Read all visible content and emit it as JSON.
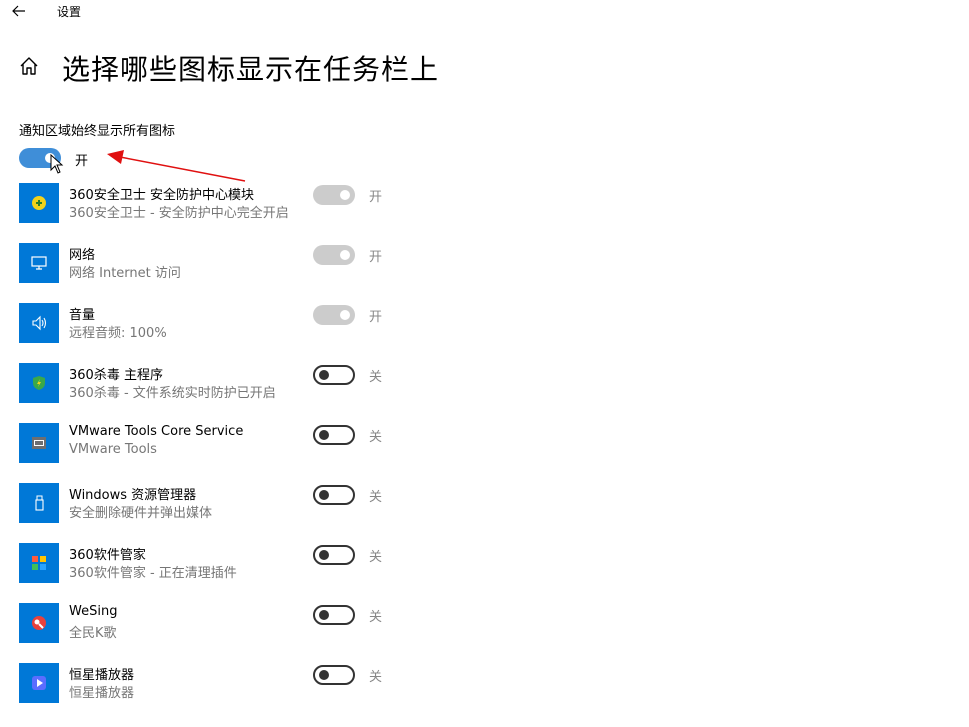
{
  "window": {
    "title": "设置"
  },
  "page": {
    "title": "选择哪些图标显示在任务栏上"
  },
  "master": {
    "label": "通知区域始终显示所有图标",
    "state": "开"
  },
  "apps": [
    {
      "name": "360安全卫士 安全防护中心模块",
      "desc": "360安全卫士 - 安全防护中心完全开启",
      "state": "开",
      "icon": "360-shield-icon"
    },
    {
      "name": "网络",
      "desc": "网络 Internet 访问",
      "state": "开",
      "icon": "network-icon"
    },
    {
      "name": "音量",
      "desc": "远程音频: 100%",
      "state": "开",
      "icon": "volume-icon"
    },
    {
      "name": "360杀毒 主程序",
      "desc": "360杀毒 - 文件系统实时防护已开启",
      "state": "关",
      "icon": "360-antivirus-icon"
    },
    {
      "name": "VMware Tools Core Service",
      "desc": "VMware Tools",
      "state": "关",
      "icon": "vmware-icon"
    },
    {
      "name": "Windows 资源管理器",
      "desc": "安全删除硬件并弹出媒体",
      "state": "关",
      "icon": "usb-eject-icon"
    },
    {
      "name": "360软件管家",
      "desc": "360软件管家 - 正在清理插件",
      "state": "关",
      "icon": "360-software-manager-icon"
    },
    {
      "name": "WeSing",
      "desc": "全民K歌",
      "state": "关",
      "icon": "wesing-icon"
    },
    {
      "name": "恒星播放器",
      "desc": "恒星播放器",
      "state": "关",
      "icon": "player-icon"
    }
  ],
  "colors": {
    "accent": "#0078d7",
    "toggle_on": "#3f8ed8",
    "annotation": "#e01010"
  }
}
